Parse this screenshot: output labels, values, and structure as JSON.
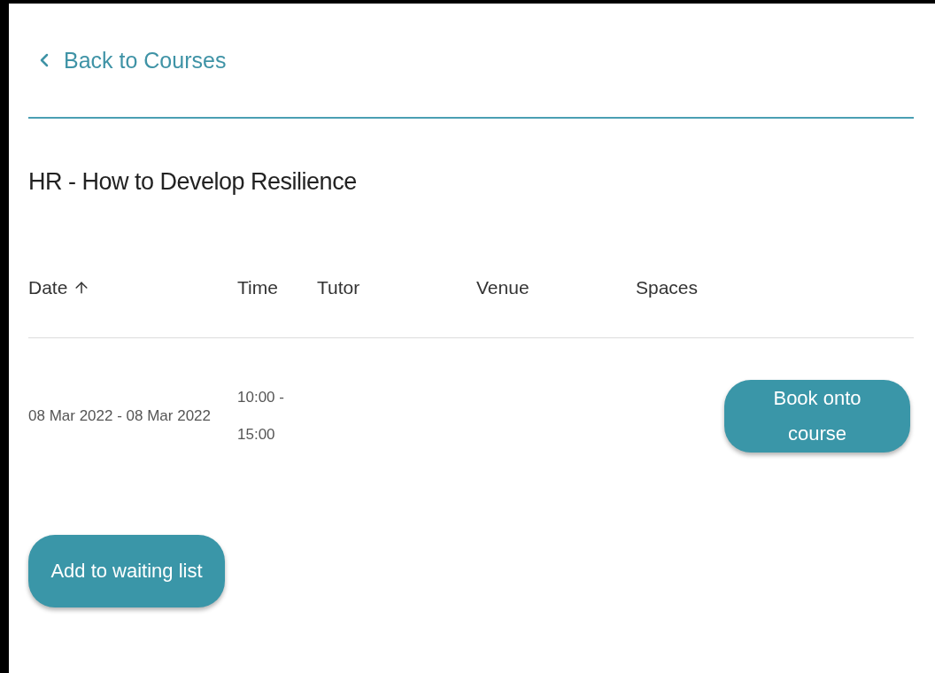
{
  "back_link": {
    "label": "Back to Courses"
  },
  "course_title": "HR - How to Develop Resilience",
  "table": {
    "columns": [
      {
        "label": "Date",
        "sorted": true
      },
      {
        "label": "Time",
        "sorted": false
      },
      {
        "label": "Tutor",
        "sorted": false
      },
      {
        "label": "Venue",
        "sorted": false
      },
      {
        "label": "Spaces",
        "sorted": false
      }
    ],
    "rows": [
      {
        "date": "08 Mar 2022 - 08 Mar 2022",
        "time": "10:00 - 15:00",
        "book_button": "Book onto course"
      }
    ]
  },
  "waiting_list_button": "Add to waiting list"
}
